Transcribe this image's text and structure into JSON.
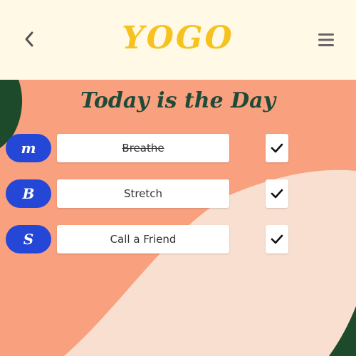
{
  "header": {
    "logo_text": "YOGO",
    "back_icon": "chevron-left-icon",
    "menu_icon": "hamburger-menu-icon"
  },
  "page": {
    "title": "Today is the Day"
  },
  "tasks": [
    {
      "day": "m",
      "label": "Breathe",
      "completed": true,
      "checked": true
    },
    {
      "day": "B",
      "label": "Stretch",
      "completed": false,
      "checked": true
    },
    {
      "day": "S",
      "label": "Call a Friend",
      "completed": false,
      "checked": true
    }
  ],
  "colors": {
    "header_bg": "#fff9e6",
    "logo": "#f6c21f",
    "title": "#1f4a38",
    "badge": "#2447d8",
    "background_salmon": "#f9a07e",
    "background_cream": "#f8dfd0",
    "background_green": "#1d4a2b"
  }
}
